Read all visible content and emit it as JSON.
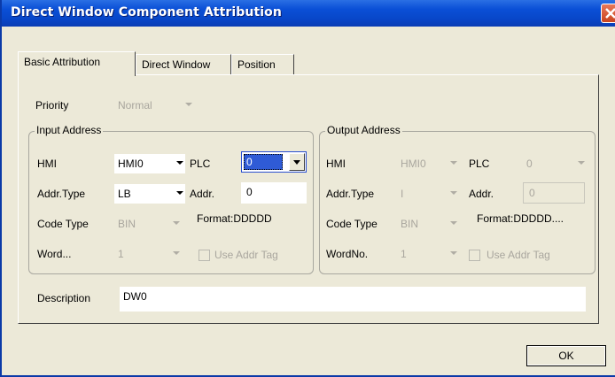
{
  "window": {
    "title": "Direct Window Component Attribution"
  },
  "tabs": [
    {
      "label": "Basic Attribution"
    },
    {
      "label": "Direct Window"
    },
    {
      "label": "Position"
    }
  ],
  "priority": {
    "label": "Priority",
    "value": "Normal"
  },
  "input_address": {
    "legend": "Input Address",
    "hmi_label": "HMI",
    "hmi_value": "HMI0",
    "plc_label": "PLC",
    "plc_value": "0",
    "addr_type_label": "Addr.Type",
    "addr_type_value": "LB",
    "addr_label": "Addr.",
    "addr_value": "0",
    "code_type_label": "Code Type",
    "code_type_value": "BIN",
    "format_text": "Format:DDDDD",
    "word_label": "Word...",
    "word_value": "1",
    "use_addr_tag_label": "Use Addr Tag"
  },
  "output_address": {
    "legend": "Output Address",
    "hmi_label": "HMI",
    "hmi_value": "HMI0",
    "plc_label": "PLC",
    "plc_value": "0",
    "addr_type_label": "Addr.Type",
    "addr_type_value": "I",
    "addr_label": "Addr.",
    "addr_value": "0",
    "code_type_label": "Code Type",
    "code_type_value": "BIN",
    "format_text": "Format:DDDDD....",
    "word_label": "WordNo.",
    "word_value": "1",
    "use_addr_tag_label": "Use Addr Tag"
  },
  "description": {
    "label": "Description",
    "value": "DW0"
  },
  "buttons": {
    "ok_label": "OK"
  }
}
